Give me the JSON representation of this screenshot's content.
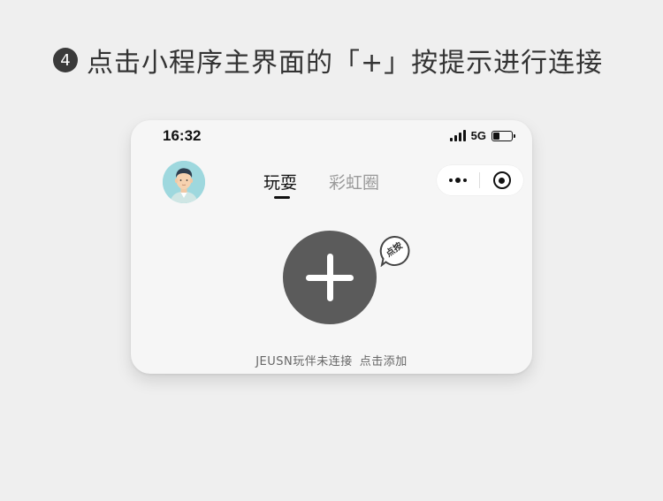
{
  "instruction": {
    "step_number": "4",
    "text": "点击小程序主界面的「+」按提示进行连接"
  },
  "status_bar": {
    "time": "16:32",
    "network": "5G",
    "battery_level": 0.35
  },
  "header": {
    "tabs": [
      {
        "label": "玩耍",
        "active": true
      },
      {
        "label": "彩虹圈",
        "active": false
      }
    ]
  },
  "main": {
    "tap_hint": "点按",
    "status_text": "JEUSN玩伴未连接",
    "action_text": "点击添加"
  },
  "colors": {
    "background": "#efefef",
    "card": "#f6f6f6",
    "add_button": "#5b5b5b",
    "avatar_bg": "#9ed8de"
  }
}
